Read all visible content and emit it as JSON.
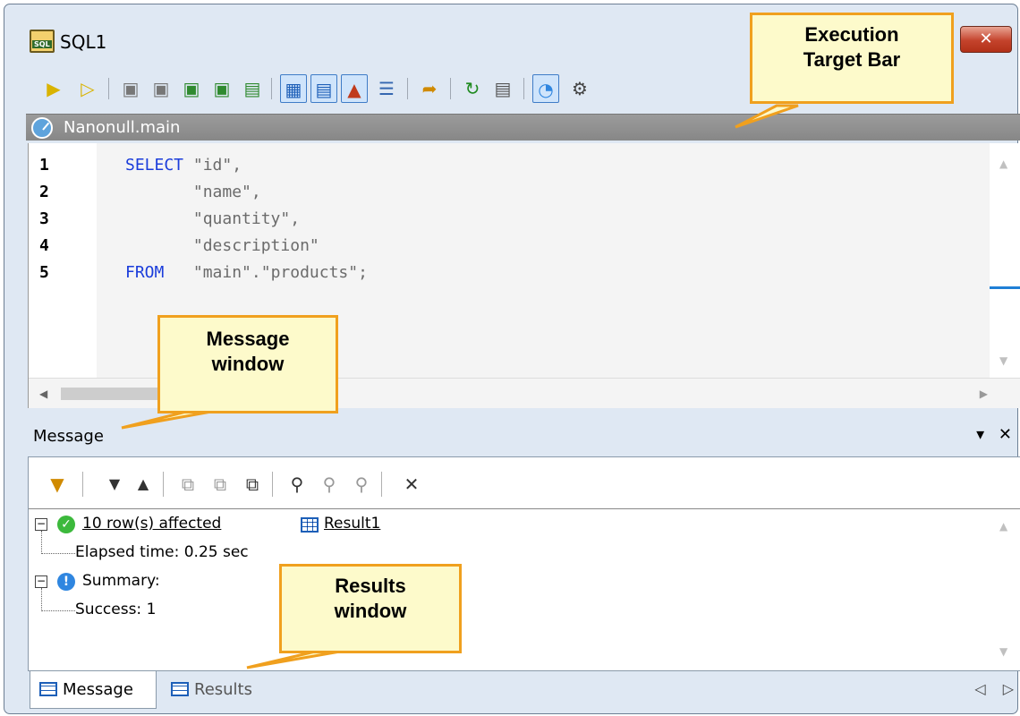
{
  "window": {
    "title": "SQL1",
    "close_label": "✕"
  },
  "toolbar": {
    "icons": [
      "execute-icon",
      "execute-for-data-editing-icon",
      "toggle-results-icon",
      "toggle-message-icon",
      "show-first-results-icon",
      "show-previous-results-icon",
      "show-all-results-icon",
      "grid-view-icon",
      "text-view-icon",
      "show-tree-icon",
      "show-properties-icon",
      "export-icon",
      "undo-icon",
      "settings-icon",
      "execution-target-icon",
      "options-icon"
    ]
  },
  "target_bar": {
    "label": "Nanonull.main"
  },
  "editor": {
    "line_numbers": [
      "1",
      "2",
      "3",
      "4",
      "5"
    ],
    "lines": [
      {
        "kw": "SELECT",
        "text": " \"id\","
      },
      {
        "kw": "",
        "text": "       \"name\","
      },
      {
        "kw": "",
        "text": "       \"quantity\","
      },
      {
        "kw": "",
        "text": "       \"description\""
      },
      {
        "kw": "FROM",
        "text": "   \"main\".\"products\";"
      }
    ]
  },
  "message_window": {
    "title": "Message",
    "collapse_label": "▾",
    "close_label": "✕",
    "tree": {
      "rows_affected": "10 row(s) affected",
      "result_link": "Result1",
      "elapsed": "Elapsed time: 0.25 sec",
      "summary": "Summary:",
      "success": "Success: 1"
    }
  },
  "bottom_tabs": {
    "message": "Message",
    "results": "Results"
  },
  "callouts": {
    "execution_target": "Execution Target Bar",
    "execution_target_line1": "Execution",
    "execution_target_line2": "Target Bar",
    "message_line1": "Message",
    "message_line2": "window",
    "results_line1": "Results",
    "results_line2": "window"
  }
}
